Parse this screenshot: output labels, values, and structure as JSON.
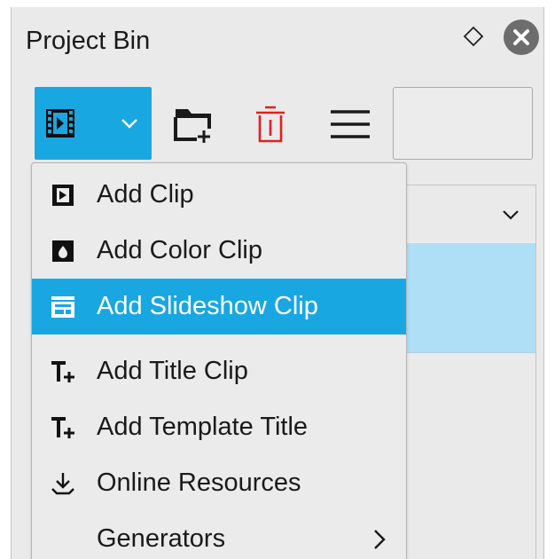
{
  "panel": {
    "title": "Project Bin"
  },
  "toolbar": {
    "search_placeholder": ""
  },
  "menu": {
    "items": [
      {
        "label": "Add Clip",
        "icon": "clip-icon",
        "active": false
      },
      {
        "label": "Add Color Clip",
        "icon": "color-clip-icon",
        "active": false
      },
      {
        "label": "Add Slideshow Clip",
        "icon": "slideshow-icon",
        "active": true
      },
      {
        "label": "Add Title Clip",
        "icon": "title-icon",
        "active": false
      },
      {
        "label": "Add Template Title",
        "icon": "template-title-icon",
        "active": false
      },
      {
        "label": "Online Resources",
        "icon": "download-icon",
        "active": false
      },
      {
        "label": "Generators",
        "icon": "",
        "active": false,
        "submenu": true
      }
    ]
  },
  "colors": {
    "accent": "#19a7e2",
    "selection": "#aedff7",
    "delete": "#e02020",
    "panel_bg": "#eaeaea"
  }
}
